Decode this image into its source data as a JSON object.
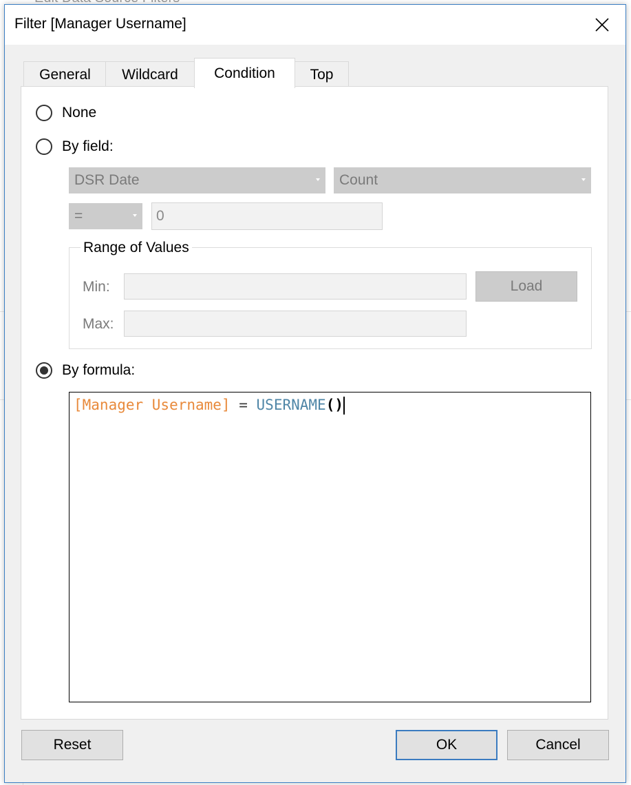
{
  "background": {
    "title": "Edit Data Source Filters"
  },
  "dialog": {
    "title": "Filter [Manager Username]",
    "tabs": [
      {
        "label": "General",
        "active": false
      },
      {
        "label": "Wildcard",
        "active": false
      },
      {
        "label": "Condition",
        "active": true
      },
      {
        "label": "Top",
        "active": false
      }
    ],
    "condition": {
      "none_label": "None",
      "by_field_label": "By field:",
      "field_select": "DSR Date",
      "aggregation_select": "Count",
      "operator_select": "=",
      "value_input": "0",
      "range_group_label": "Range of Values",
      "min_label": "Min:",
      "max_label": "Max:",
      "min_value": "",
      "max_value": "",
      "load_label": "Load",
      "by_formula_label": "By formula:",
      "selected_option": "By formula:",
      "formula": {
        "field": "[Manager Username]",
        "operator": "=",
        "function": "USERNAME",
        "parens": "()"
      }
    },
    "buttons": {
      "reset": "Reset",
      "ok": "OK",
      "cancel": "Cancel"
    },
    "icons": {
      "close": "close-icon"
    },
    "colors": {
      "formula_field": "#e8893a",
      "formula_function": "#4f86a7",
      "dialog_border": "#3b7fc4"
    }
  }
}
